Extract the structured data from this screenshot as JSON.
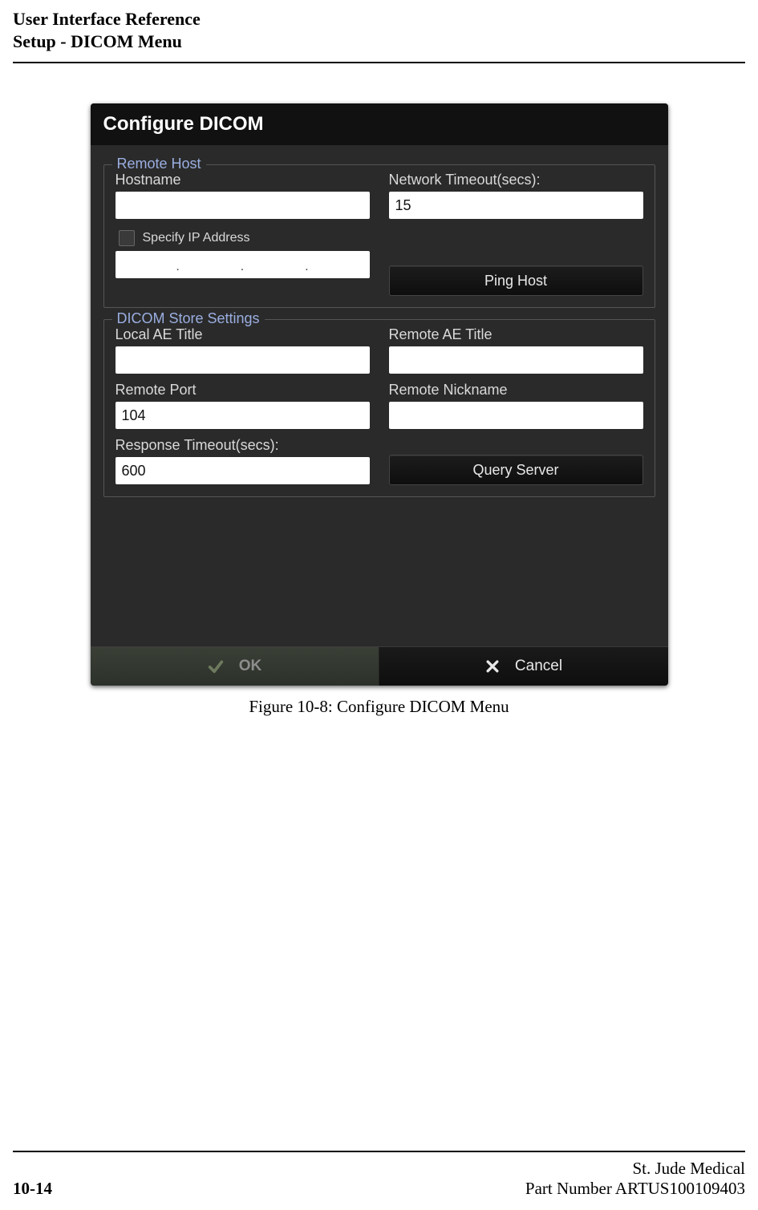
{
  "header": {
    "line1": "User Interface Reference",
    "line2": "Setup - DICOM Menu"
  },
  "dialog": {
    "title": "Configure DICOM",
    "remote_host": {
      "legend": "Remote Host",
      "hostname_label": "Hostname",
      "hostname_value": "",
      "timeout_label": "Network Timeout(secs):",
      "timeout_value": "15",
      "specify_ip_label": "Specify IP Address",
      "ping_label": "Ping Host"
    },
    "store": {
      "legend": "DICOM Store Settings",
      "local_ae_label": "Local AE Title",
      "local_ae_value": "",
      "remote_ae_label": "Remote AE Title",
      "remote_ae_value": "",
      "remote_port_label": "Remote Port",
      "remote_port_value": "104",
      "remote_nick_label": "Remote Nickname",
      "remote_nick_value": "",
      "resp_timeout_label": "Response Timeout(secs):",
      "resp_timeout_value": "600",
      "query_label": "Query Server"
    },
    "actions": {
      "ok": "OK",
      "cancel": "Cancel"
    }
  },
  "caption": "Figure 10-8:  Configure DICOM Menu",
  "footer": {
    "page_number": "10-14",
    "company": "St. Jude Medical",
    "part_number": "Part Number ARTUS100109403"
  }
}
